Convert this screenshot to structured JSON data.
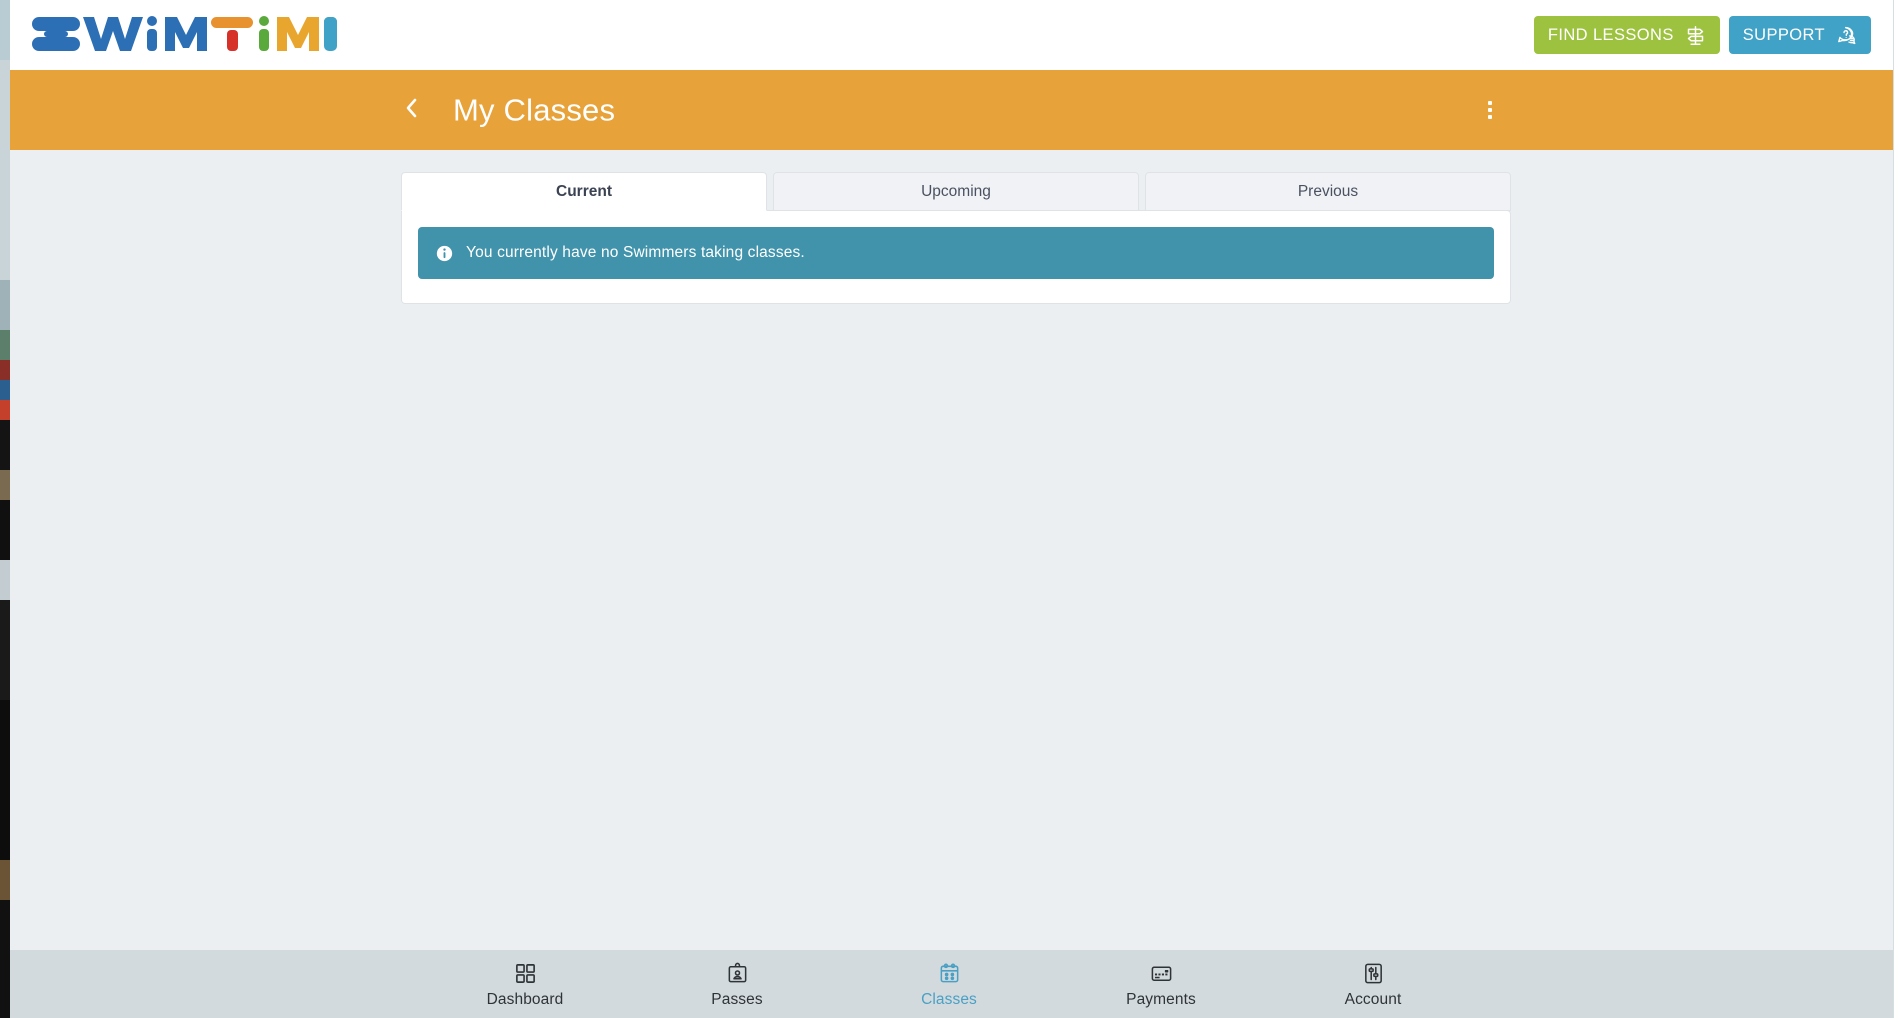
{
  "brand": {
    "logo_text": "SWiMTiME",
    "logo_letters": [
      {
        "char": "S",
        "color": "#2c6fb5"
      },
      {
        "char": "W",
        "color": "#2c6fb5"
      },
      {
        "char": "i",
        "color": "#2c6fb5"
      },
      {
        "char": "M",
        "color": "#2c6fb5"
      },
      {
        "char": "T",
        "color": "#e8912f"
      },
      {
        "char": "i",
        "color": "#5aa93c"
      },
      {
        "char": "M",
        "color": "#e8a62f"
      },
      {
        "char": "E",
        "color": "#3fa2c6"
      }
    ]
  },
  "topbar": {
    "find_lessons_label": "FIND LESSONS",
    "find_lessons_icon": "signpost-icon",
    "find_lessons_color": "#9dc23f",
    "support_label": "SUPPORT",
    "support_icon": "question-chat-icon",
    "support_color": "#3fa2c6"
  },
  "pageheader": {
    "back_icon": "chevron-left-icon",
    "title": "My Classes",
    "menu_icon": "kebab-menu-icon",
    "background_color": "#e8a23a"
  },
  "tabs": [
    {
      "label": "Current",
      "active": true
    },
    {
      "label": "Upcoming",
      "active": false
    },
    {
      "label": "Previous",
      "active": false
    }
  ],
  "alert": {
    "icon": "info-circle-icon",
    "message": "You currently have no Swimmers taking classes.",
    "background_color": "#4093ab"
  },
  "bottomnav": {
    "items": [
      {
        "label": "Dashboard",
        "icon": "grid-icon",
        "active": false
      },
      {
        "label": "Passes",
        "icon": "id-badge-icon",
        "active": false
      },
      {
        "label": "Classes",
        "icon": "calendar-icon",
        "active": true
      },
      {
        "label": "Payments",
        "icon": "credit-card-icon",
        "active": false
      },
      {
        "label": "Account",
        "icon": "sliders-icon",
        "active": false
      }
    ],
    "active_color": "#4aa0c4",
    "background_color": "#d3dadd"
  }
}
